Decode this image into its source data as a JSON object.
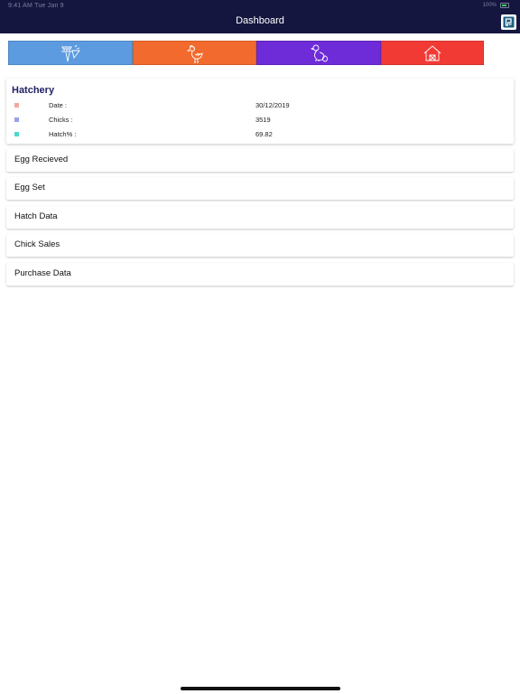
{
  "status_bar": {
    "time": "9:41 AM  Tue Jan 9",
    "battery": "100%"
  },
  "header": {
    "title": "Dashboard",
    "logo_icon": "app-logo-icon"
  },
  "tabs": [
    {
      "icon": "feed-icon",
      "color": "#5c9be0"
    },
    {
      "icon": "hen-icon",
      "color": "#f26a2e"
    },
    {
      "icon": "chick-icon",
      "color": "#6e2bd8"
    },
    {
      "icon": "barn-icon",
      "color": "#f23a35"
    }
  ],
  "card": {
    "title": "Hatchery",
    "rows": [
      {
        "label": "Date :",
        "value": "30/12/2019",
        "color": "#f3a6a0"
      },
      {
        "label": "Chicks :",
        "value": "3519",
        "color": "#9aa1ea"
      },
      {
        "label": "Hatch% :",
        "value": "69.82",
        "color": "#4ad9cc"
      }
    ]
  },
  "list": [
    {
      "label": "Egg Recieved"
    },
    {
      "label": "Egg Set"
    },
    {
      "label": "Hatch Data"
    },
    {
      "label": "Chick Sales"
    },
    {
      "label": "Purchase Data"
    }
  ]
}
